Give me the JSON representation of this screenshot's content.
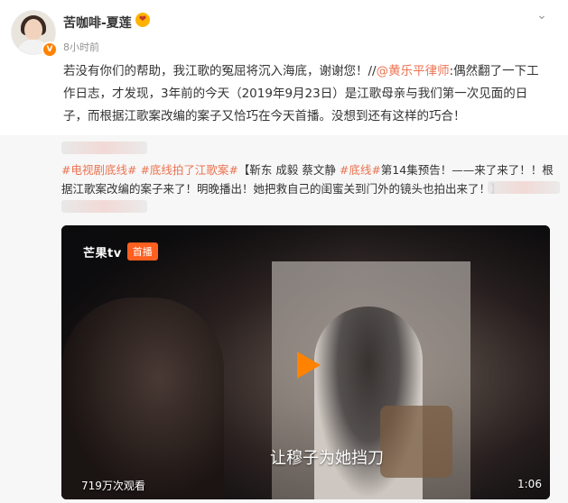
{
  "author": {
    "name": "苦咖啡-夏莲",
    "time": "8小时前",
    "badge_icon": "verified-badge-icon",
    "emoji_icon": "kiss-emoji-icon"
  },
  "post": {
    "text_prefix": "若没有你们的帮助，我江歌的冤屈将沉入海底，谢谢您！//",
    "mention": "@黄乐平律师",
    "text_suffix": ":偶然翻了一下工作日志，才发现，3年前的今天（2019年9月23日）是江歌母亲与我们第一次见面的日子，而根据江歌案改编的案子又恰巧在今天首播。没想到还有这样的巧合！"
  },
  "repost": {
    "hashtags": [
      "#电视剧底线#",
      "#底线拍了江歌案#"
    ],
    "text_bracket_open": "【",
    "text_main": "靳东 成毅 蔡文静",
    "hashtag_inline": "#底线#",
    "text_rest": "第14集预告！——来了来了！！根据江歌案改编的案子来了！明晚播出！她把救自己的闺蜜关到门外的镜头也拍出来了！】"
  },
  "video": {
    "brand": "芒果tv",
    "live_label": "首播",
    "subtitle": "让穆子为她挡刀",
    "views": "719万次观看",
    "duration": "1:06"
  },
  "colors": {
    "accent": "#eb7350",
    "verified": "#ff8200"
  }
}
